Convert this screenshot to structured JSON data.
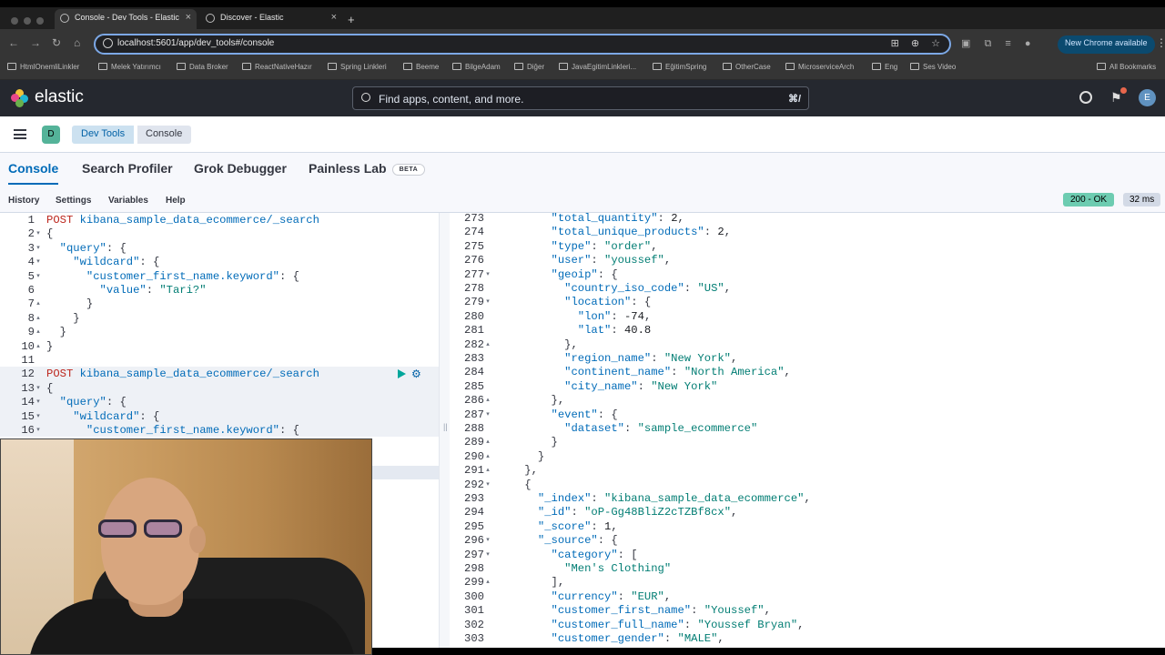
{
  "browser": {
    "tabs": [
      {
        "title": "Console - Dev Tools - Elastic",
        "active": true
      },
      {
        "title": "Discover - Elastic",
        "active": false
      }
    ],
    "new_tab": "+",
    "url": "localhost:5601/app/dev_tools#/console",
    "update_button": "New Chrome available",
    "bookmarks": [
      "HtmlOnemliLinkler",
      "Melek Yatırımcı",
      "Data Broker",
      "ReactNativeHazır",
      "Spring Linkleri",
      "Beeme",
      "BilgeAdam",
      "Diğer",
      "JavaEgitimLinkleri...",
      "EğitimSpring",
      "OtherCase",
      "MicroserviceArch",
      "Eng",
      "Ses Video"
    ],
    "all_bookmarks": "All Bookmarks"
  },
  "kibana": {
    "brand": "elastic",
    "search_placeholder": "Find apps, content, and more.",
    "search_shortcut": "⌘/",
    "avatar_initial": "E",
    "space_initial": "D",
    "breadcrumbs": [
      "Dev Tools",
      "Console"
    ],
    "app_tabs": [
      "Console",
      "Search Profiler",
      "Grok Debugger",
      "Painless Lab"
    ],
    "beta_label": "BETA",
    "sub_links": [
      "History",
      "Settings",
      "Variables",
      "Help"
    ],
    "response_status": "200 - OK",
    "response_time": "32 ms"
  },
  "request_editor": {
    "lines": [
      {
        "n": "1",
        "fold": "",
        "html": "<span class=\"m\">POST</span> <span class=\"u\">kibana_sample_data_ecommerce/_search</span>"
      },
      {
        "n": "2",
        "fold": "▾",
        "html": "{"
      },
      {
        "n": "3",
        "fold": "▾",
        "html": "  <span class=\"k\">\"query\"</span>: {"
      },
      {
        "n": "4",
        "fold": "▾",
        "html": "    <span class=\"k\">\"wildcard\"</span>: {"
      },
      {
        "n": "5",
        "fold": "▾",
        "html": "      <span class=\"k\">\"customer_first_name.keyword\"</span>: {"
      },
      {
        "n": "6",
        "fold": "",
        "html": "        <span class=\"k\">\"value\"</span>: <span class=\"s\">\"Tari?\"</span>"
      },
      {
        "n": "7",
        "fold": "▴",
        "html": "      }"
      },
      {
        "n": "8",
        "fold": "▴",
        "html": "    }"
      },
      {
        "n": "9",
        "fold": "▴",
        "html": "  }"
      },
      {
        "n": "10",
        "fold": "▴",
        "html": "}"
      },
      {
        "n": "11",
        "fold": "",
        "html": ""
      },
      {
        "n": "12",
        "fold": "",
        "html": "<span class=\"m\">POST</span> <span class=\"u\">kibana_sample_data_ecommerce/_search</span>"
      },
      {
        "n": "13",
        "fold": "▾",
        "html": "{"
      },
      {
        "n": "14",
        "fold": "▾",
        "html": "  <span class=\"k\">\"query\"</span>: {"
      },
      {
        "n": "15",
        "fold": "▾",
        "html": "    <span class=\"k\">\"wildcard\"</span>: {"
      },
      {
        "n": "16",
        "fold": "▾",
        "html": "      <span class=\"k\">\"customer_first_name.keyword\"</span>: {"
      }
    ]
  },
  "response_editor": {
    "lines": [
      {
        "n": "273",
        "fold": "",
        "html": "        <span class=\"k\">\"total_quantity\"</span>: <span class=\"n\">2</span>,"
      },
      {
        "n": "274",
        "fold": "",
        "html": "        <span class=\"k\">\"total_unique_products\"</span>: <span class=\"n\">2</span>,"
      },
      {
        "n": "275",
        "fold": "",
        "html": "        <span class=\"k\">\"type\"</span>: <span class=\"s\">\"order\"</span>,"
      },
      {
        "n": "276",
        "fold": "",
        "html": "        <span class=\"k\">\"user\"</span>: <span class=\"s\">\"youssef\"</span>,"
      },
      {
        "n": "277",
        "fold": "▾",
        "html": "        <span class=\"k\">\"geoip\"</span>: {"
      },
      {
        "n": "278",
        "fold": "",
        "html": "          <span class=\"k\">\"country_iso_code\"</span>: <span class=\"s\">\"US\"</span>,"
      },
      {
        "n": "279",
        "fold": "▾",
        "html": "          <span class=\"k\">\"location\"</span>: {"
      },
      {
        "n": "280",
        "fold": "",
        "html": "            <span class=\"k\">\"lon\"</span>: <span class=\"n\">-74</span>,"
      },
      {
        "n": "281",
        "fold": "",
        "html": "            <span class=\"k\">\"lat\"</span>: <span class=\"n\">40.8</span>"
      },
      {
        "n": "282",
        "fold": "▴",
        "html": "          },"
      },
      {
        "n": "283",
        "fold": "",
        "html": "          <span class=\"k\">\"region_name\"</span>: <span class=\"s\">\"New York\"</span>,"
      },
      {
        "n": "284",
        "fold": "",
        "html": "          <span class=\"k\">\"continent_name\"</span>: <span class=\"s\">\"North America\"</span>,"
      },
      {
        "n": "285",
        "fold": "",
        "html": "          <span class=\"k\">\"city_name\"</span>: <span class=\"s\">\"New York\"</span>"
      },
      {
        "n": "286",
        "fold": "▴",
        "html": "        },"
      },
      {
        "n": "287",
        "fold": "▾",
        "html": "        <span class=\"k\">\"event\"</span>: {"
      },
      {
        "n": "288",
        "fold": "",
        "html": "          <span class=\"k\">\"dataset\"</span>: <span class=\"s\">\"sample_ecommerce\"</span>"
      },
      {
        "n": "289",
        "fold": "▴",
        "html": "        }"
      },
      {
        "n": "290",
        "fold": "▴",
        "html": "      }"
      },
      {
        "n": "291",
        "fold": "▴",
        "html": "    },"
      },
      {
        "n": "292",
        "fold": "▾",
        "html": "    {"
      },
      {
        "n": "293",
        "fold": "",
        "html": "      <span class=\"k\">\"_index\"</span>: <span class=\"s\">\"kibana_sample_data_ecommerce\"</span>,"
      },
      {
        "n": "294",
        "fold": "",
        "html": "      <span class=\"k\">\"_id\"</span>: <span class=\"s\">\"oP-Gg48BliZ2cTZBf8cx\"</span>,"
      },
      {
        "n": "295",
        "fold": "",
        "html": "      <span class=\"k\">\"_score\"</span>: <span class=\"n\">1</span>,"
      },
      {
        "n": "296",
        "fold": "▾",
        "html": "      <span class=\"k\">\"_source\"</span>: {"
      },
      {
        "n": "297",
        "fold": "▾",
        "html": "        <span class=\"k\">\"category\"</span>: ["
      },
      {
        "n": "298",
        "fold": "",
        "html": "          <span class=\"s\">\"Men's Clothing\"</span>"
      },
      {
        "n": "299",
        "fold": "▴",
        "html": "        ],"
      },
      {
        "n": "300",
        "fold": "",
        "html": "        <span class=\"k\">\"currency\"</span>: <span class=\"s\">\"EUR\"</span>,"
      },
      {
        "n": "301",
        "fold": "",
        "html": "        <span class=\"k\">\"customer_first_name\"</span>: <span class=\"s\">\"Youssef\"</span>,"
      },
      {
        "n": "302",
        "fold": "",
        "html": "        <span class=\"k\">\"customer_full_name\"</span>: <span class=\"s\">\"Youssef Bryan\"</span>,"
      },
      {
        "n": "303",
        "fold": "",
        "html": "        <span class=\"k\">\"customer_gender\"</span>: <span class=\"s\">\"MALE\"</span>,"
      }
    ]
  },
  "icons": {
    "back": "back-arrow-icon",
    "forward": "forward-arrow-icon",
    "reload": "reload-icon",
    "home": "home-icon",
    "translate": "translate-icon",
    "zoom": "zoom-icon",
    "star": "bookmark-star-icon",
    "help": "help-icon",
    "news": "newsfeed-icon",
    "run": "play-icon",
    "wrench": "wrench-icon"
  },
  "colors": {
    "kibana_header": "#25282f",
    "accent": "#006bb8",
    "status_ok": "#6dccb1",
    "http_method": "#bd271e",
    "string": "#017d73"
  }
}
